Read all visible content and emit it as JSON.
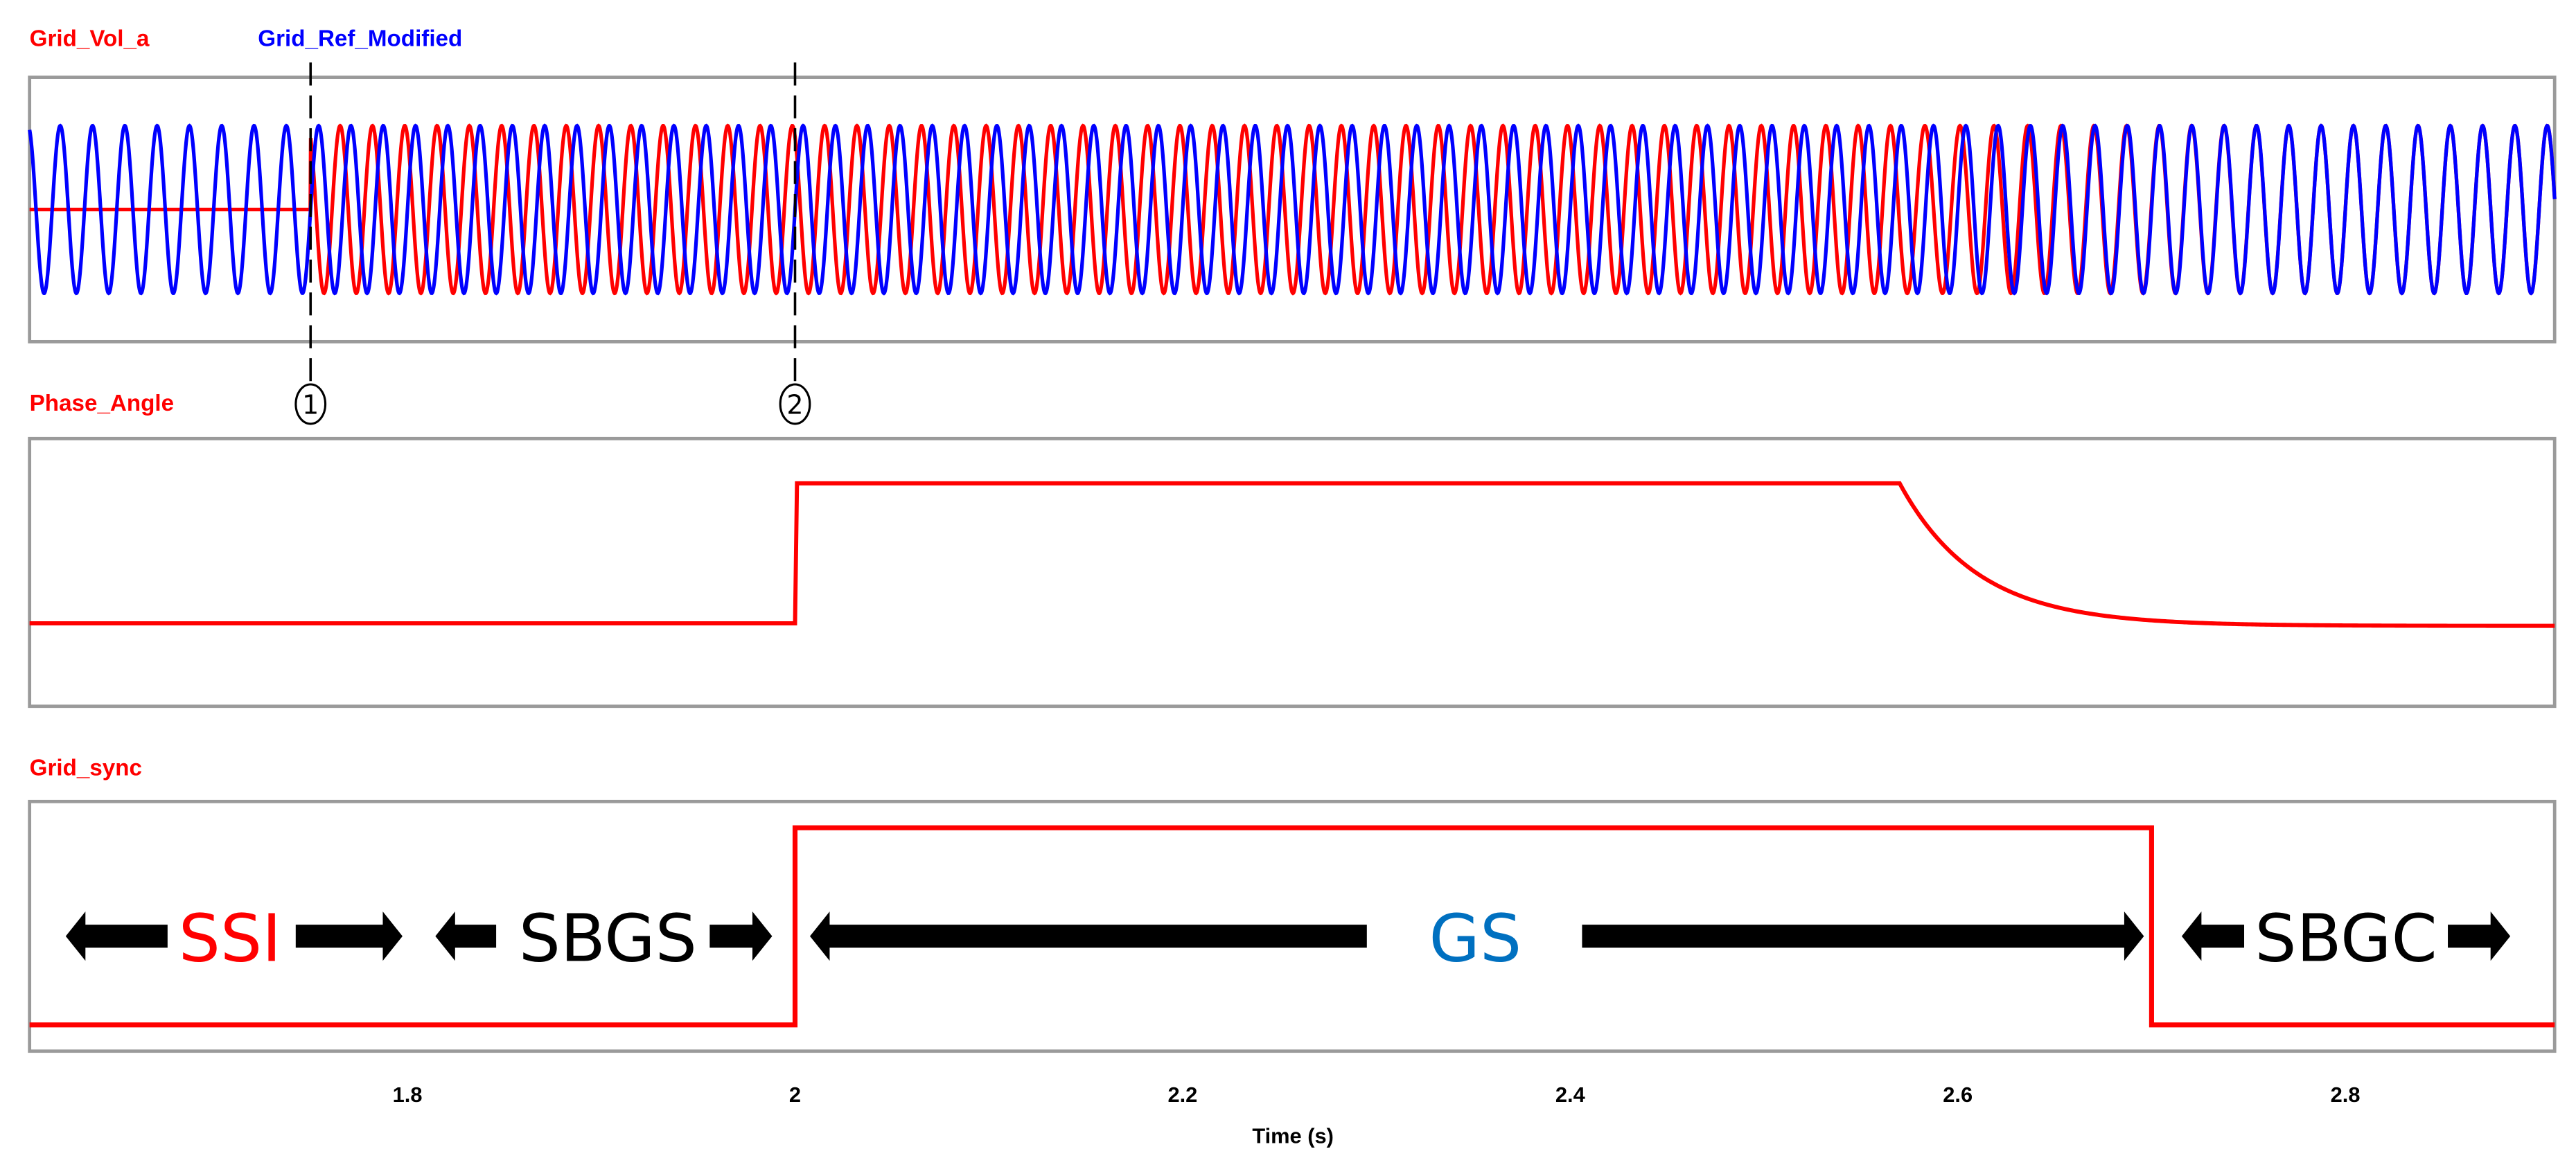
{
  "chart_data": [
    {
      "type": "line",
      "panel": "voltage",
      "title": "",
      "legend": [
        "Grid_Vol_a",
        "Grid_Ref_Modified"
      ],
      "legend_placement": "top-left",
      "series": [
        {
          "name": "Grid_Vol_a",
          "color": "#ff0000",
          "kind": "sinusoid",
          "frequency_hz": 60,
          "amplitude": 1,
          "start_time": 1.75,
          "value_before_start": 0,
          "phase_offset_deg_initial": 120,
          "note_points": [
            [
              1.6,
              0
            ],
            [
              1.75,
              0
            ]
          ]
        },
        {
          "name": "Grid_Ref_Modified",
          "color": "#0000ff",
          "kind": "sinusoid",
          "frequency_hz": 60,
          "amplitude": 1
        }
      ],
      "xlim": [
        1.605,
        2.908
      ],
      "ylim": [
        -1.5,
        1.5
      ],
      "markers": [
        {
          "label": "①",
          "t": 1.75
        },
        {
          "label": "②",
          "t": 2.0
        }
      ]
    },
    {
      "type": "line",
      "panel": "phase",
      "legend": [
        "Phase_Angle"
      ],
      "series": [
        {
          "name": "Phase_Angle",
          "color": "#ff0000",
          "x": [
            1.605,
            1.999,
            2.0,
            2.57,
            2.6,
            2.63,
            2.66,
            2.7,
            2.75,
            2.8,
            2.908
          ],
          "y": [
            0.3,
            0.3,
            0.85,
            0.85,
            0.6,
            0.45,
            0.36,
            0.31,
            0.295,
            0.29,
            0.29
          ]
        }
      ],
      "xlim": [
        1.605,
        2.908
      ],
      "ylim": [
        0,
        1
      ]
    },
    {
      "type": "line",
      "panel": "sync",
      "legend": [
        "Grid_sync"
      ],
      "series": [
        {
          "name": "Grid_sync",
          "color": "#ff0000",
          "x": [
            1.605,
            2.0,
            2.0,
            2.7,
            2.7,
            2.908
          ],
          "y": [
            0,
            0,
            1,
            1,
            0,
            0
          ]
        }
      ],
      "xlim": [
        1.605,
        2.908
      ],
      "ylim": [
        -0.1,
        1.1
      ],
      "annotations": [
        {
          "text": "SSI",
          "color": "#ff0000"
        },
        {
          "text": "SBGS",
          "color": "#000000"
        },
        {
          "text": "GS",
          "color": "#0070c0"
        },
        {
          "text": "SBGC",
          "color": "#000000"
        }
      ],
      "xlabel": "Time (s)",
      "xticks": [
        1.8,
        2,
        2.2,
        2.4,
        2.6,
        2.8
      ],
      "xtick_labels": [
        "1.8",
        "2",
        "2.2",
        "2.4",
        "2.6",
        "2.8"
      ]
    }
  ]
}
